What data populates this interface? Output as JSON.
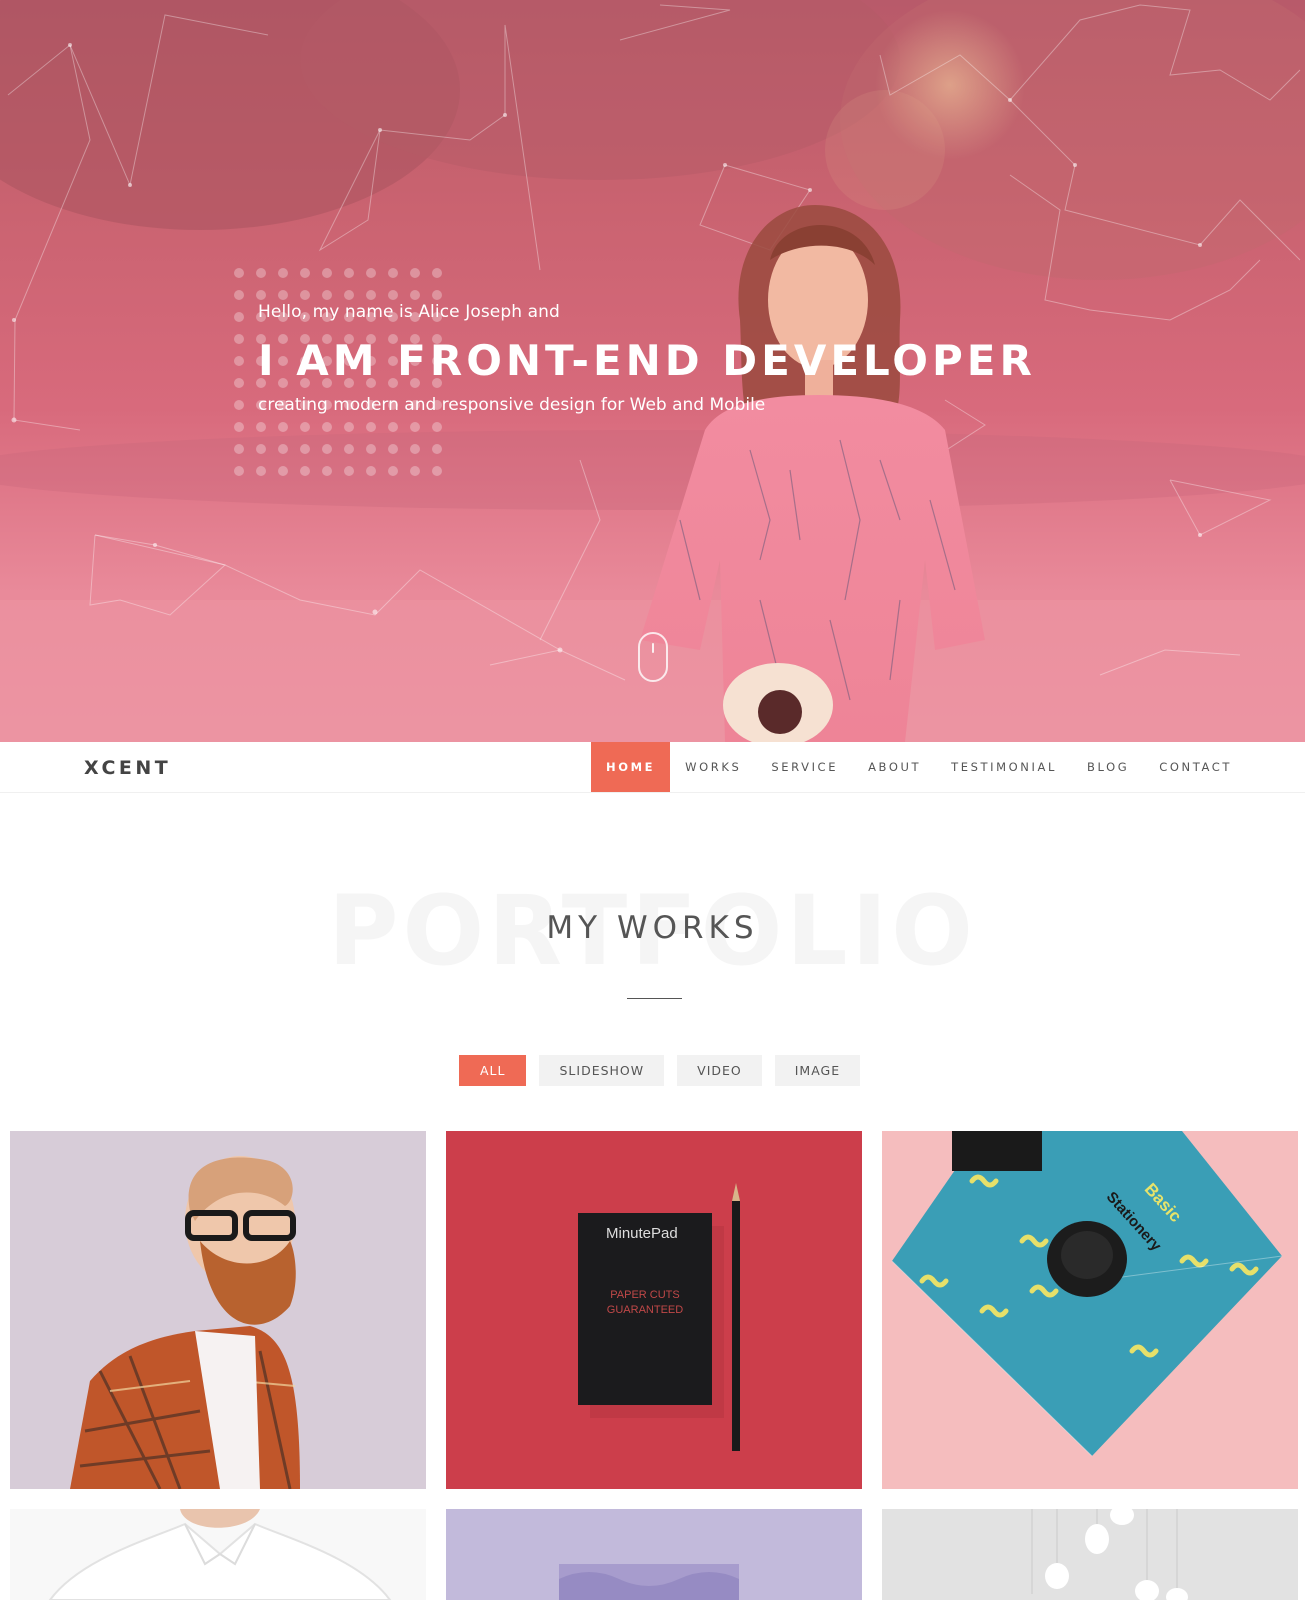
{
  "hero": {
    "greeting": "Hello, my name is Alice Joseph and",
    "title": "I AM FRONT-END DEVELOPER",
    "subtitle": "creating modern and responsive design for Web and Mobile"
  },
  "navbar": {
    "brand": "XCENT",
    "items": [
      {
        "label": "HOME",
        "active": true
      },
      {
        "label": "WORKS",
        "active": false
      },
      {
        "label": "SERVICE",
        "active": false
      },
      {
        "label": "ABOUT",
        "active": false
      },
      {
        "label": "TESTIMONIAL",
        "active": false
      },
      {
        "label": "BLOG",
        "active": false
      },
      {
        "label": "CONTACT",
        "active": false
      }
    ]
  },
  "works": {
    "background_word": "PORTFOLIO",
    "title": "MY WORKS",
    "filters": [
      {
        "label": "ALL",
        "active": true
      },
      {
        "label": "SLIDESHOW",
        "active": false
      },
      {
        "label": "VIDEO",
        "active": false
      },
      {
        "label": "IMAGE",
        "active": false
      }
    ],
    "items": [
      {
        "name": "bearded-man-portrait"
      },
      {
        "name": "minutepad-notebook",
        "brand": "MinutePad",
        "tagline_1": "PAPER CUTS",
        "tagline_2": "GUARANTEED"
      },
      {
        "name": "basic-stationery-envelope",
        "text_1": "Basic",
        "text_2": "Stationery"
      },
      {
        "name": "man-white-shirt"
      },
      {
        "name": "purple-card"
      },
      {
        "name": "hanging-bulbs"
      }
    ]
  },
  "colors": {
    "accent": "#ef6a55",
    "hero_overlay": "#d86a7c",
    "text_dark": "#555555"
  }
}
